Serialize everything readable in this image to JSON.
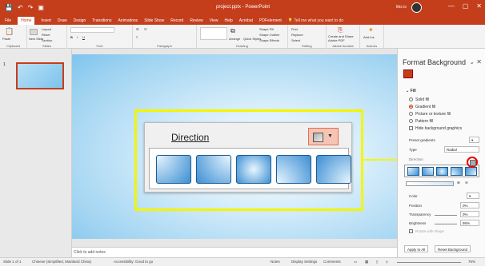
{
  "titlebar": {
    "doc_title": "project.pptx - PowerPoint",
    "user": "this is",
    "minimize": "—",
    "maximize": "▢",
    "close": "✕"
  },
  "tabs": [
    "File",
    "Home",
    "Insert",
    "Draw",
    "Design",
    "Transitions",
    "Animations",
    "Slide Show",
    "Record",
    "Review",
    "View",
    "Help",
    "Acrobat",
    "PDFelement"
  ],
  "tellme": "Tell me what you want to do",
  "ribbon": {
    "paste": "Paste",
    "clipboard": "Clipboard",
    "new_slide": "New Slide",
    "layout": "Layout",
    "reset": "Reset",
    "section": "Section",
    "slides": "Slides",
    "font": "Font",
    "paragraph": "Paragraph",
    "arrange": "Arrange",
    "quick_styles": "Quick Styles",
    "shape_fill": "Shape Fill",
    "shape_outline": "Shape Outline",
    "shape_effects": "Shape Effects",
    "drawing": "Drawing",
    "find": "Find",
    "replace": "Replace",
    "select": "Select",
    "editing": "Editing",
    "create_share": "Create and Share Adobe PDF",
    "adobe_acrobat": "Adobe Acrobat",
    "addins": "Add-ins",
    "addins_group": "Add-ins"
  },
  "slide_panel": {
    "thumb_number": "1"
  },
  "zoom_callout": {
    "label": "Direction",
    "arrow": "▼"
  },
  "notes_placeholder": "Click to add notes",
  "format_pane": {
    "title": "Format Background",
    "fill_section": "Fill",
    "options": [
      "Solid fill",
      "Gradient fill",
      "Picture or texture fill",
      "Pattern fill"
    ],
    "selected_option": "Gradient fill",
    "hide_bg": "Hide background graphics",
    "preset_gradients": "Preset gradients",
    "type_label": "Type",
    "type_value": "Radial",
    "direction_label": "Direction",
    "gradient_stops": "Gradient stops",
    "color_label": "Color",
    "position_label": "Position",
    "position_value": "0%",
    "transparency_label": "Transparency",
    "transparency_value": "0%",
    "brightness_label": "Brightness",
    "brightness_value": "95%",
    "rotate_label": "Rotate with shape",
    "apply_all": "Apply to All",
    "reset_bg": "Reset Background"
  },
  "status": {
    "slide_info": "Slide 1 of 1",
    "language": "Chinese (Simplified, Mainland China)",
    "accessibility": "Accessibility: Good to go",
    "notes": "Notes",
    "display_settings": "Display Settings",
    "comments": "Comments",
    "zoom": "76%"
  },
  "colors": {
    "accent": "#c43e1c",
    "highlight": "#f5f500",
    "tile_border": "#1e5a90"
  }
}
